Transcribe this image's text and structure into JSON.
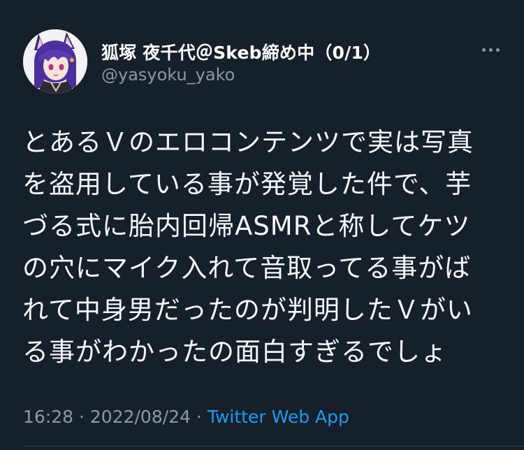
{
  "author": {
    "display_name": "狐塚 夜千代＠Skeb締め中（0/1）",
    "handle": "@yasyoku_yako",
    "avatar_icon": "avatar-purple-hair-fox-ears"
  },
  "tweet": {
    "lines": [
      "とあるＶのエロコンテンツで実は写真",
      "を盗用している事が発覚した件で、芋",
      "づる式に胎内回帰ASMRと称してケツ",
      "の穴にマイク入れて音取ってる事がば",
      "れて中身男だったのが判明したＶがい",
      "る事がわかったの面白すぎるでしょ"
    ]
  },
  "meta": {
    "time": "16:28",
    "separator1": " · ",
    "date": "2022/08/24",
    "separator2": " · ",
    "source": "Twitter Web App"
  },
  "colors": {
    "background": "#15202b",
    "text": "#ffffff",
    "secondary": "#8b98a5",
    "accent": "#1d9bf0"
  }
}
